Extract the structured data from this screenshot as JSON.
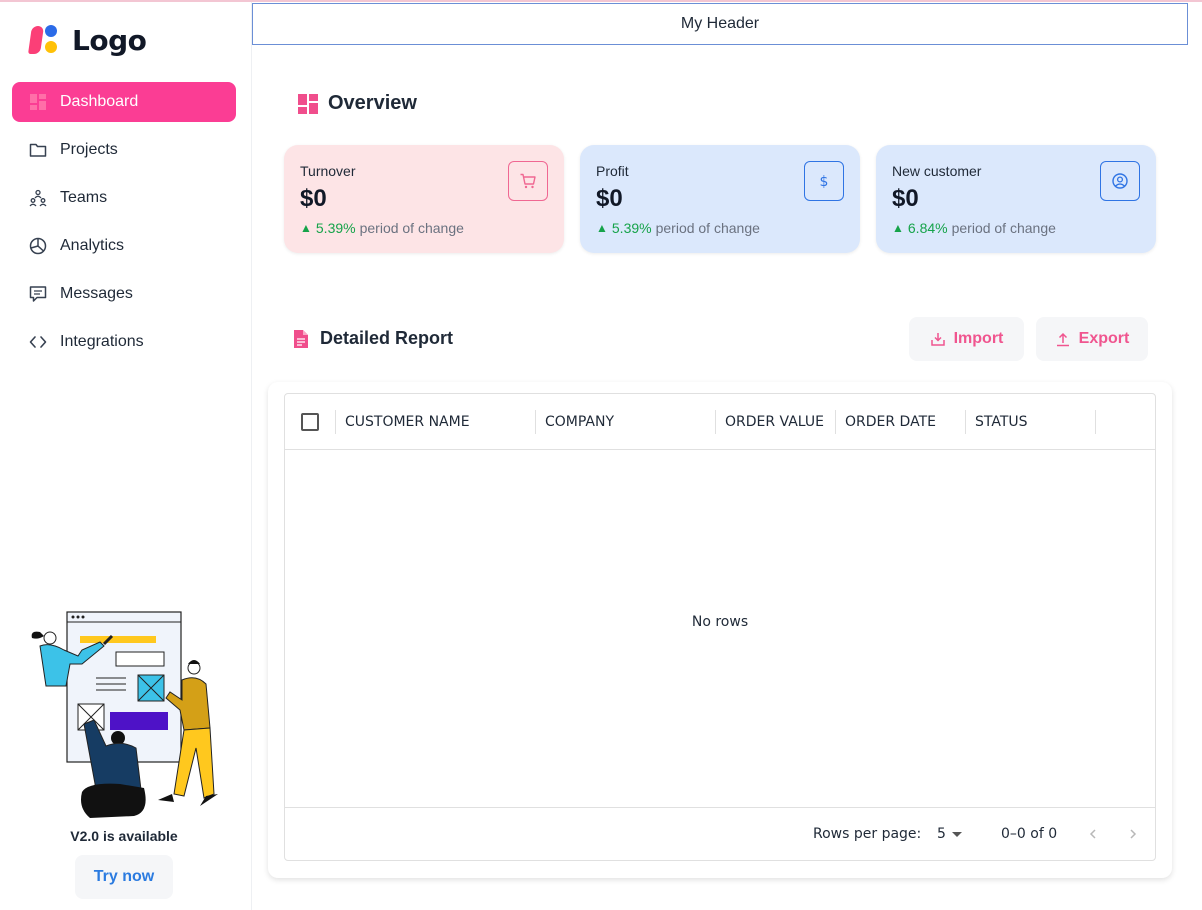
{
  "app": {
    "logo_text": "Logo",
    "header_title": "My Header"
  },
  "sidebar": {
    "items": [
      {
        "label": "Dashboard",
        "icon": "dashboard-grid-icon",
        "active": true
      },
      {
        "label": "Projects",
        "icon": "folder-icon",
        "active": false
      },
      {
        "label": "Teams",
        "icon": "team-hierarchy-icon",
        "active": false
      },
      {
        "label": "Analytics",
        "icon": "pie-chart-icon",
        "active": false
      },
      {
        "label": "Messages",
        "icon": "message-icon",
        "active": false
      },
      {
        "label": "Integrations",
        "icon": "code-brackets-icon",
        "active": false
      }
    ],
    "promo_text": "V2.0 is available",
    "promo_button": "Try now"
  },
  "overview": {
    "title": "Overview",
    "cards": [
      {
        "title": "Turnover",
        "value": "$0",
        "change_pct": "5.39%",
        "change_text": "period of change",
        "icon": "cart-icon"
      },
      {
        "title": "Profit",
        "value": "$0",
        "change_pct": "5.39%",
        "change_text": "period of change",
        "icon": "dollar-icon"
      },
      {
        "title": "New customer",
        "value": "$0",
        "change_pct": "6.84%",
        "change_text": "period of change",
        "icon": "user-circle-icon"
      }
    ]
  },
  "report": {
    "title": "Detailed Report",
    "import_label": "Import",
    "export_label": "Export",
    "columns": [
      "CUSTOMER NAME",
      "COMPANY",
      "ORDER VALUE",
      "ORDER DATE",
      "STATUS"
    ],
    "empty_text": "No rows",
    "rows_per_page_label": "Rows per page:",
    "rows_per_page_value": "5",
    "range_text": "0–0 of 0"
  },
  "colors": {
    "accent": "#fb3d94",
    "pink_card": "#fde4e6",
    "blue_card": "#dbe8fc",
    "positive": "#16a34a",
    "link_blue": "#2b7be0"
  }
}
